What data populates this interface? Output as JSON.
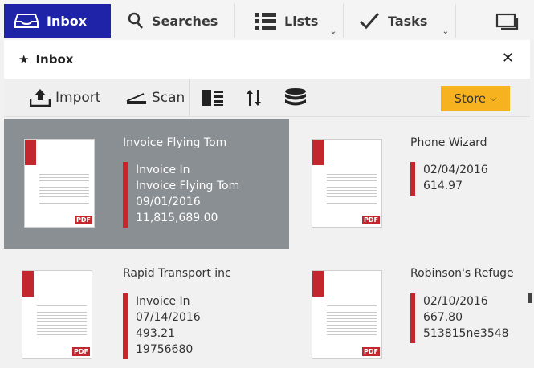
{
  "nav": {
    "tabs": [
      {
        "label": "Inbox",
        "icon": "inbox-tray-icon"
      },
      {
        "label": "Searches",
        "icon": "search-icon"
      },
      {
        "label": "Lists",
        "icon": "list-icon"
      },
      {
        "label": "Tasks",
        "icon": "checkmark-icon"
      }
    ],
    "active_color": "#1f23a8"
  },
  "header": {
    "title": "Inbox",
    "icon": "star-icon"
  },
  "toolbar": {
    "import_label": "Import",
    "scan_label": "Scan",
    "store_label": "Store",
    "store_color": "#f6b21f"
  },
  "documents": [
    {
      "title": "Invoice Flying Tom",
      "fields": [
        "Invoice In",
        "Invoice Flying Tom",
        "09/01/2016",
        "11,815,689.00"
      ],
      "selected": true
    },
    {
      "title": "Phone Wizard",
      "fields": [
        "02/04/2016",
        "614.97"
      ],
      "selected": false
    },
    {
      "title": "Rapid Transport inc",
      "fields": [
        "Invoice In",
        "07/14/2016",
        "493.21",
        "19756680"
      ],
      "selected": false
    },
    {
      "title": "Robinson's Refuge",
      "fields": [
        "02/10/2016",
        "667.80",
        "513815ne3548"
      ],
      "selected": false
    }
  ],
  "pdf_badge": "PDF",
  "accent_color": "#c1272d"
}
